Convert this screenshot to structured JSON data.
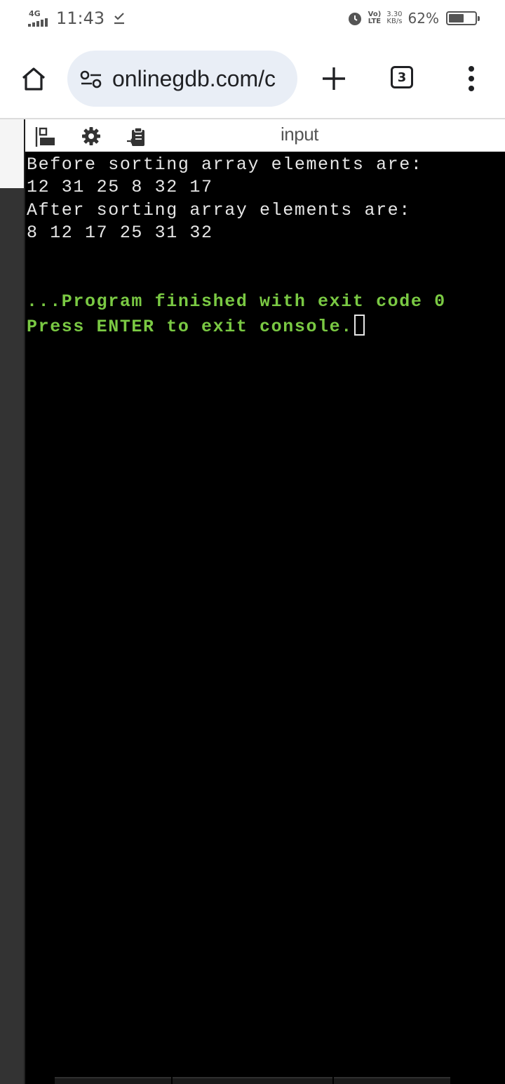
{
  "status_bar": {
    "network": "4G",
    "time": "11:43",
    "volte_top": "Vo)",
    "volte_bottom": "LTE",
    "speed_value": "3.30",
    "speed_unit": "KB/s",
    "battery_percent": "62%",
    "battery_level": 0.62
  },
  "browser": {
    "url": "onlinegdb.com/c",
    "tab_count": "3"
  },
  "console_header": {
    "input_label": "input"
  },
  "console": {
    "lines": [
      "Before sorting array elements are:",
      "12 31 25 8 32 17",
      "After sorting array elements are:",
      "8 12 17 25 31 32"
    ],
    "finish_line": "...Program finished with exit code 0",
    "prompt_line": "Press ENTER to exit console."
  },
  "colors": {
    "console_bg": "#000000",
    "console_text": "#e6e6e6",
    "success_text": "#7ac943"
  }
}
